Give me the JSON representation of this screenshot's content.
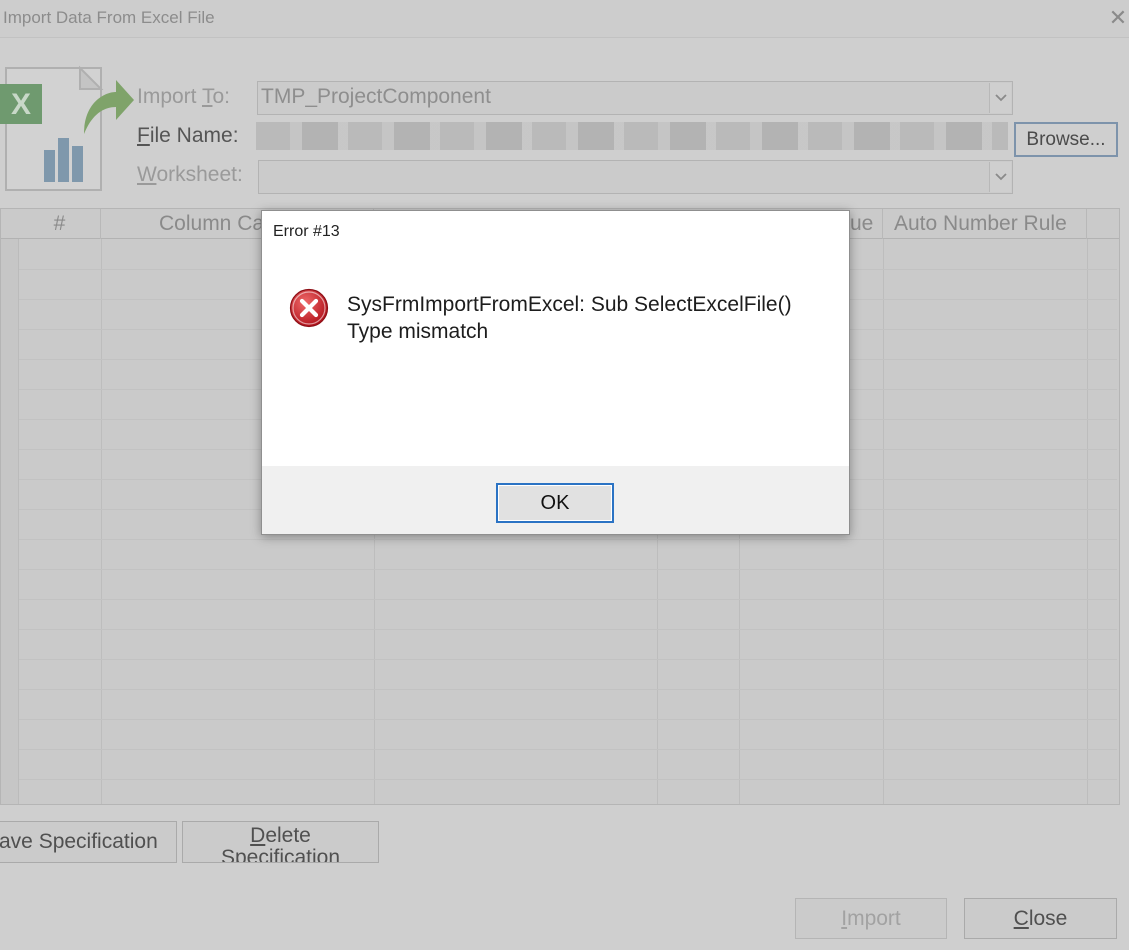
{
  "window": {
    "title": "Import Data From Excel File",
    "close_glyph": "✕"
  },
  "form": {
    "import_to_label_pre": "Import ",
    "import_to_label_key": "T",
    "import_to_label_post": "o:",
    "import_to_value": "TMP_ProjectComponent",
    "file_name_label_key": "F",
    "file_name_label_post": "ile Name:",
    "worksheet_label_key": "W",
    "worksheet_label_post": "orksheet:",
    "worksheet_value": "",
    "browse_label": "Browse..."
  },
  "grid": {
    "columns": [
      "#",
      "Column Ca",
      "ue",
      "Auto Number Rule"
    ]
  },
  "buttons": {
    "save_spec_label": "ave Specification",
    "delete_spec_line1_key": "D",
    "delete_spec_line1_post": "elete",
    "delete_spec_line2": "Specification",
    "import_label_key": "I",
    "import_label_post": "mport",
    "close_label_key": "C",
    "close_label_post": "lose"
  },
  "error_dialog": {
    "title": "Error #13",
    "message_line1": "SysFrmImportFromExcel: Sub SelectExcelFile()",
    "message_line2": "Type mismatch",
    "ok_label": "OK",
    "icon": "error-x-icon"
  },
  "colors": {
    "error_red": "#d0202a",
    "focus_blue": "#2b73c4",
    "excel_green": "#5b8f5b"
  }
}
